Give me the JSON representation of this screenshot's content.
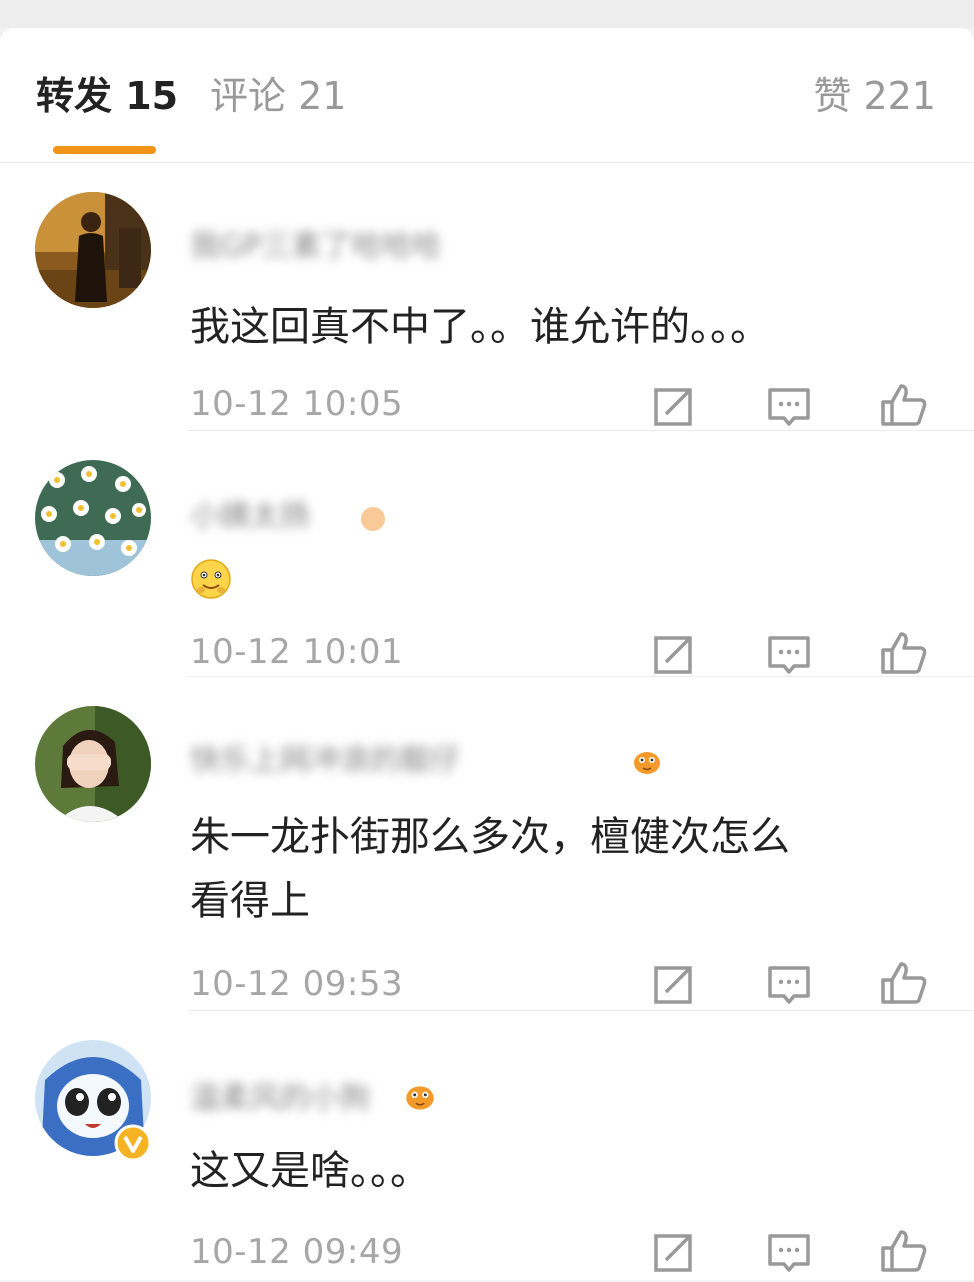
{
  "tabs": {
    "repost": "转发 15",
    "comments": "评论 21",
    "likes": "赞 221"
  },
  "accent_color": "#f29418",
  "comments": [
    {
      "username": "我GP三素了哈哈哈",
      "text": "我这回真不中了。。谁允许的。。。",
      "time": "10-12 10:05",
      "avatar": "avatar-woman-dark-dress"
    },
    {
      "username": "小姨太扬",
      "emoji": "smiley-face-emoji",
      "time": "10-12 10:01",
      "avatar": "avatar-daisies"
    },
    {
      "username": "快乐上网冲浪的靓仔",
      "text_line1": "朱一龙扑街那么多次，檀健次怎么",
      "text_line2": "看得上",
      "time": "10-12 09:53",
      "avatar": "avatar-girl-covering-face"
    },
    {
      "username": "温柔风的小狗",
      "text": "这又是啥。。。",
      "time": "10-12 09:49",
      "avatar": "avatar-cartoon-girl-verified"
    }
  ],
  "icons": [
    "repost-icon",
    "comment-icon",
    "like-icon"
  ]
}
